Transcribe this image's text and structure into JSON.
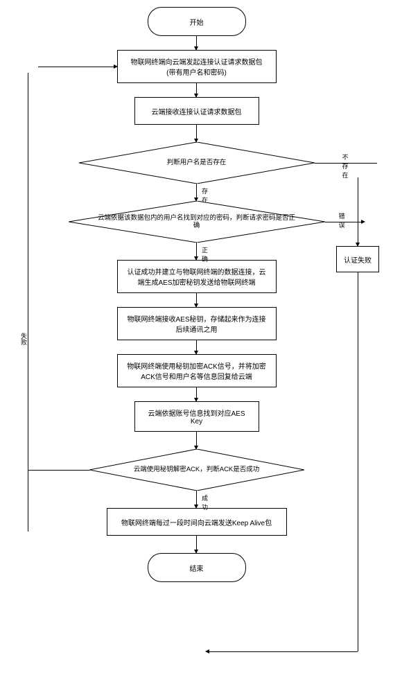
{
  "flowchart": {
    "start": "开始",
    "step1": "物联网终端向云端发起连接认证请求数据包\n(带有用户名和密码)",
    "step2": "云端接收连接认证请求数据包",
    "decision1": "判断用户名是否存在",
    "decision1_yes": "存在",
    "decision1_no": "不存在",
    "decision2": "云端依据该数据包内的用户名找到对应的密码，判断请求密码是否正确",
    "decision2_yes": "正确",
    "decision2_no": "错误",
    "auth_fail": "认证失败",
    "step3": "认证成功并建立与物联网终端的数据连接，云端生成AES加密秘钥发送给物联网终端",
    "step4": "物联网终端接收AES秘钥，存储起来作为连接后续通讯之用",
    "step5": "物联网终端使用秘钥加密ACK信号，并将加密ACK信号和用户名等信息回复给云端",
    "step6": "云端依据账号信息找到对应AES Key",
    "decision3": "云端使用秘钥解密ACK，判断ACK是否成功",
    "decision3_yes": "成功",
    "decision3_no": "失败",
    "step7": "物联网终端每过一段时间向云端发送Keep Alive包",
    "end": "结束"
  }
}
